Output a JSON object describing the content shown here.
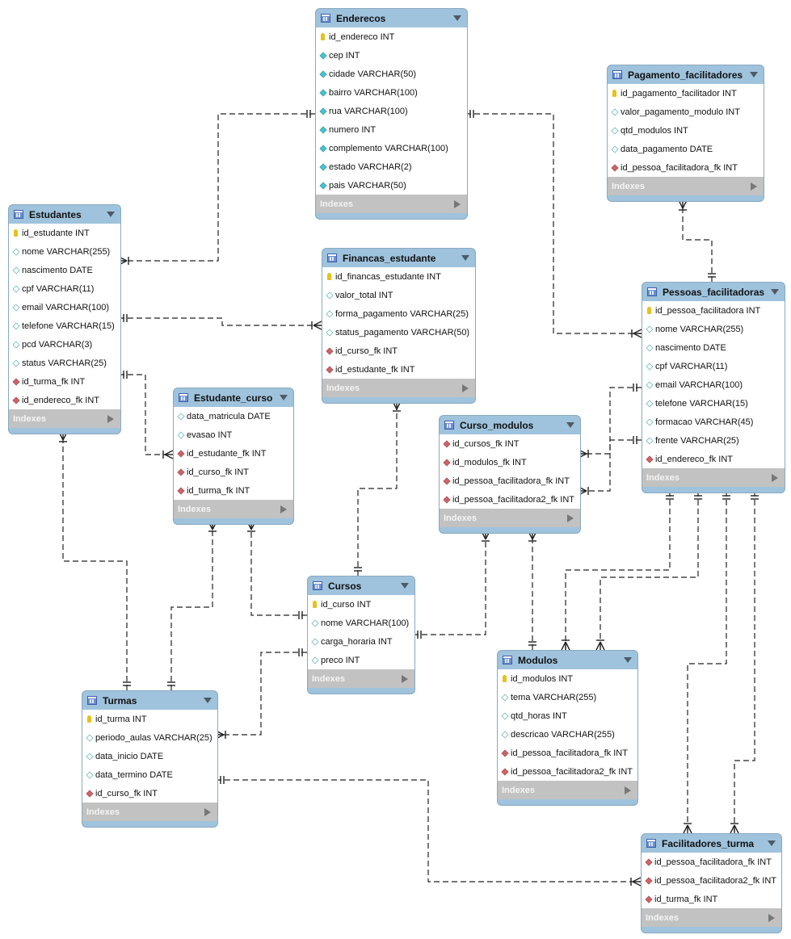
{
  "indexes_label": "Indexes",
  "colors": {
    "header": "#9fc3dd",
    "indexes": "#c2c2c2",
    "pk": "#e8c21c",
    "fk": "#c9666a",
    "not_null": "#4fc0cf"
  },
  "tables": [
    {
      "name": "Enderecos",
      "columns": [
        {
          "text": "id_endereco INT",
          "icon": "pk"
        },
        {
          "text": "cep INT",
          "icon": "nn"
        },
        {
          "text": "cidade VARCHAR(50)",
          "icon": "nn"
        },
        {
          "text": "bairro VARCHAR(100)",
          "icon": "nn"
        },
        {
          "text": "rua VARCHAR(100)",
          "icon": "nn"
        },
        {
          "text": "numero INT",
          "icon": "nn"
        },
        {
          "text": "complemento VARCHAR(100)",
          "icon": "nn"
        },
        {
          "text": "estado VARCHAR(2)",
          "icon": "nn"
        },
        {
          "text": "pais VARCHAR(50)",
          "icon": "nn"
        }
      ]
    },
    {
      "name": "Estudantes",
      "columns": [
        {
          "text": "id_estudante INT",
          "icon": "pk"
        },
        {
          "text": "nome VARCHAR(255)",
          "icon": "nullable"
        },
        {
          "text": "nascimento DATE",
          "icon": "nullable"
        },
        {
          "text": "cpf VARCHAR(11)",
          "icon": "nullable"
        },
        {
          "text": "email VARCHAR(100)",
          "icon": "nullable"
        },
        {
          "text": "telefone VARCHAR(15)",
          "icon": "nullable"
        },
        {
          "text": "pcd VARCHAR(3)",
          "icon": "nullable"
        },
        {
          "text": "status VARCHAR(25)",
          "icon": "nullable"
        },
        {
          "text": "id_turma_fk INT",
          "icon": "fk"
        },
        {
          "text": "id_endereco_fk INT",
          "icon": "fk"
        }
      ]
    },
    {
      "name": "Pagamento_facilitadores",
      "columns": [
        {
          "text": "id_pagamento_facilitador INT",
          "icon": "pk"
        },
        {
          "text": "valor_pagamento_modulo INT",
          "icon": "nullable"
        },
        {
          "text": "qtd_modulos INT",
          "icon": "nullable"
        },
        {
          "text": "data_pagamento DATE",
          "icon": "nullable"
        },
        {
          "text": "id_pessoa_facilitadora_fk INT",
          "icon": "fk"
        }
      ]
    },
    {
      "name": "Financas_estudante",
      "columns": [
        {
          "text": "id_financas_estudante INT",
          "icon": "pk"
        },
        {
          "text": "valor_total INT",
          "icon": "nullable"
        },
        {
          "text": "forma_pagamento VARCHAR(25)",
          "icon": "nullable"
        },
        {
          "text": "status_pagamento VARCHAR(50)",
          "icon": "nullable"
        },
        {
          "text": "id_curso_fk INT",
          "icon": "fk"
        },
        {
          "text": "id_estudante_fk INT",
          "icon": "fk"
        }
      ]
    },
    {
      "name": "Pessoas_facilitadoras",
      "columns": [
        {
          "text": "id_pessoa_facilitadora INT",
          "icon": "pk"
        },
        {
          "text": "nome VARCHAR(255)",
          "icon": "nullable"
        },
        {
          "text": "nascimento DATE",
          "icon": "nullable"
        },
        {
          "text": "cpf VARCHAR(11)",
          "icon": "nullable"
        },
        {
          "text": "email VARCHAR(100)",
          "icon": "nullable"
        },
        {
          "text": "telefone VARCHAR(15)",
          "icon": "nullable"
        },
        {
          "text": "formacao VARCHAR(45)",
          "icon": "nullable"
        },
        {
          "text": "frente VARCHAR(25)",
          "icon": "nullable"
        },
        {
          "text": "id_endereco_fk INT",
          "icon": "fk"
        }
      ]
    },
    {
      "name": "Estudante_curso",
      "columns": [
        {
          "text": "data_matricula DATE",
          "icon": "nullable"
        },
        {
          "text": "evasao INT",
          "icon": "nullable"
        },
        {
          "text": "id_estudante_fk INT",
          "icon": "fk"
        },
        {
          "text": "id_curso_fk INT",
          "icon": "fk"
        },
        {
          "text": "id_turma_fk INT",
          "icon": "fk"
        }
      ]
    },
    {
      "name": "Curso_modulos",
      "columns": [
        {
          "text": "id_cursos_fk INT",
          "icon": "fk"
        },
        {
          "text": "id_modulos_fk INT",
          "icon": "fk"
        },
        {
          "text": "id_pessoa_facilitadora_fk INT",
          "icon": "fk"
        },
        {
          "text": "id_pessoa_facilitadora2_fk INT",
          "icon": "fk"
        }
      ]
    },
    {
      "name": "Cursos",
      "columns": [
        {
          "text": "id_curso INT",
          "icon": "pk"
        },
        {
          "text": "nome VARCHAR(100)",
          "icon": "nullable"
        },
        {
          "text": "carga_horaria INT",
          "icon": "nullable"
        },
        {
          "text": "preco INT",
          "icon": "nullable"
        }
      ]
    },
    {
      "name": "Modulos",
      "columns": [
        {
          "text": "id_modulos INT",
          "icon": "pk"
        },
        {
          "text": "tema VARCHAR(255)",
          "icon": "nullable"
        },
        {
          "text": "qtd_horas INT",
          "icon": "nullable"
        },
        {
          "text": "descricao VARCHAR(255)",
          "icon": "nullable"
        },
        {
          "text": "id_pessoa_facilitadora_fk INT",
          "icon": "fk"
        },
        {
          "text": "id_pessoa_facilitadora2_fk INT",
          "icon": "fk"
        }
      ]
    },
    {
      "name": "Turmas",
      "columns": [
        {
          "text": "id_turma INT",
          "icon": "pk"
        },
        {
          "text": "periodo_aulas VARCHAR(25)",
          "icon": "nullable"
        },
        {
          "text": "data_inicio DATE",
          "icon": "nullable"
        },
        {
          "text": "data_termino DATE",
          "icon": "nullable"
        },
        {
          "text": "id_curso_fk INT",
          "icon": "fk"
        }
      ]
    },
    {
      "name": "Facilitadores_turma",
      "columns": [
        {
          "text": "id_pessoa_facilitadora_fk INT",
          "icon": "fk"
        },
        {
          "text": "id_pessoa_facilitadora2_fk INT",
          "icon": "fk"
        },
        {
          "text": "id_turma_fk INT",
          "icon": "fk"
        }
      ]
    }
  ]
}
